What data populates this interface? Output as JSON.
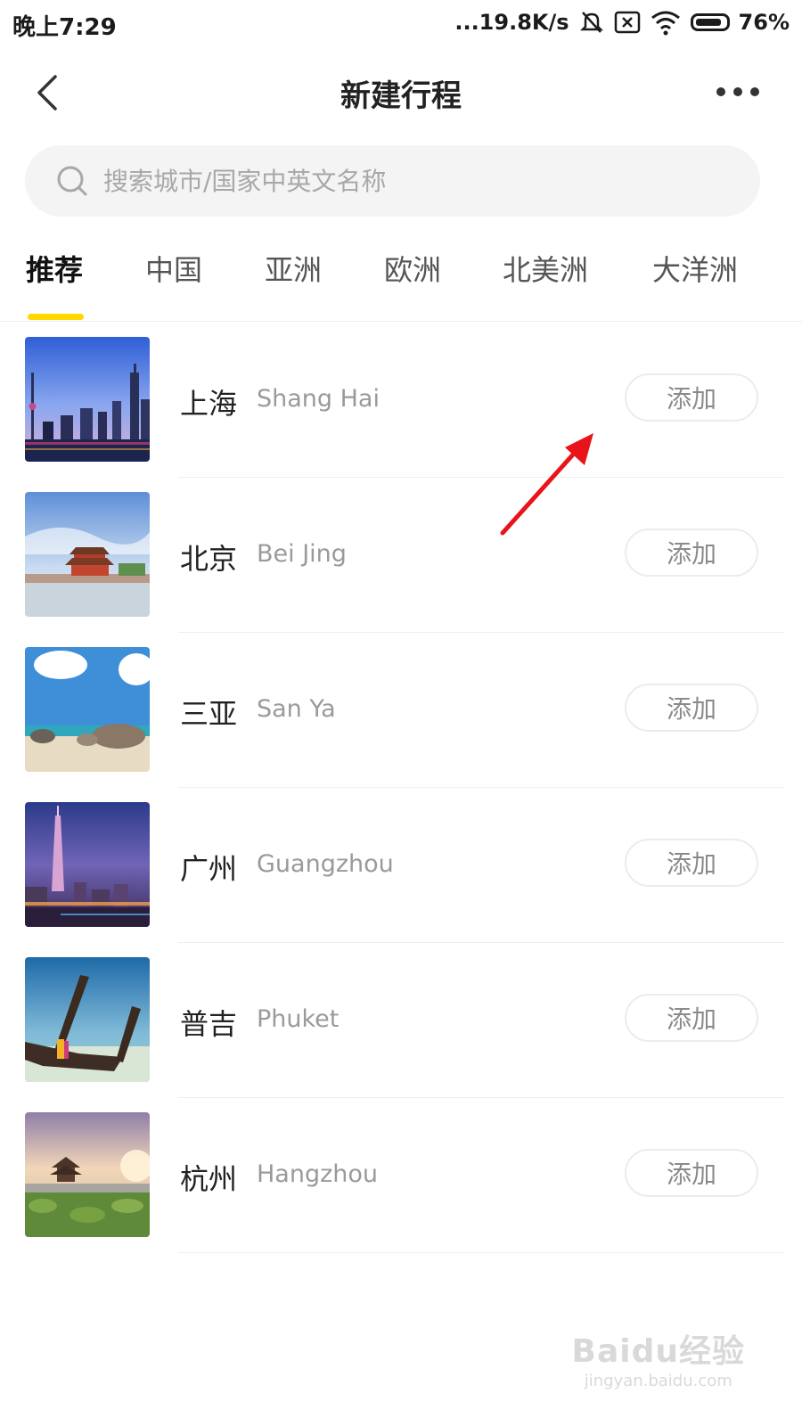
{
  "status_bar": {
    "time": "晚上7:29",
    "network_speed": "...19.8K/s",
    "battery": "76%"
  },
  "nav": {
    "title": "新建行程"
  },
  "search": {
    "placeholder": "搜索城市/国家中英文名称",
    "value": ""
  },
  "tabs": [
    {
      "label": "推荐",
      "active": true
    },
    {
      "label": "中国"
    },
    {
      "label": "亚洲"
    },
    {
      "label": "欧洲"
    },
    {
      "label": "北美洲"
    },
    {
      "label": "大洋洲"
    }
  ],
  "cities": [
    {
      "name_cn": "上海",
      "name_en": "Shang Hai",
      "action": "添加",
      "image": "shanghai-skyline"
    },
    {
      "name_cn": "北京",
      "name_en": "Bei Jing",
      "action": "添加",
      "image": "forbidden-city-tower"
    },
    {
      "name_cn": "三亚",
      "name_en": "San Ya",
      "action": "添加",
      "image": "beach-rocks"
    },
    {
      "name_cn": "广州",
      "name_en": "Guangzhou",
      "action": "添加",
      "image": "canton-tower-night"
    },
    {
      "name_cn": "普吉",
      "name_en": "Phuket",
      "action": "添加",
      "image": "longtail-boat"
    },
    {
      "name_cn": "杭州",
      "name_en": "Hangzhou",
      "action": "添加",
      "image": "west-lake-pavilion"
    }
  ],
  "colors": {
    "accent": "#ffd800",
    "annotation_arrow": "#e8141a",
    "search_bg": "#f4f4f4"
  },
  "watermark": {
    "logo": "Baidu经验",
    "url": "jingyan.baidu.com"
  }
}
